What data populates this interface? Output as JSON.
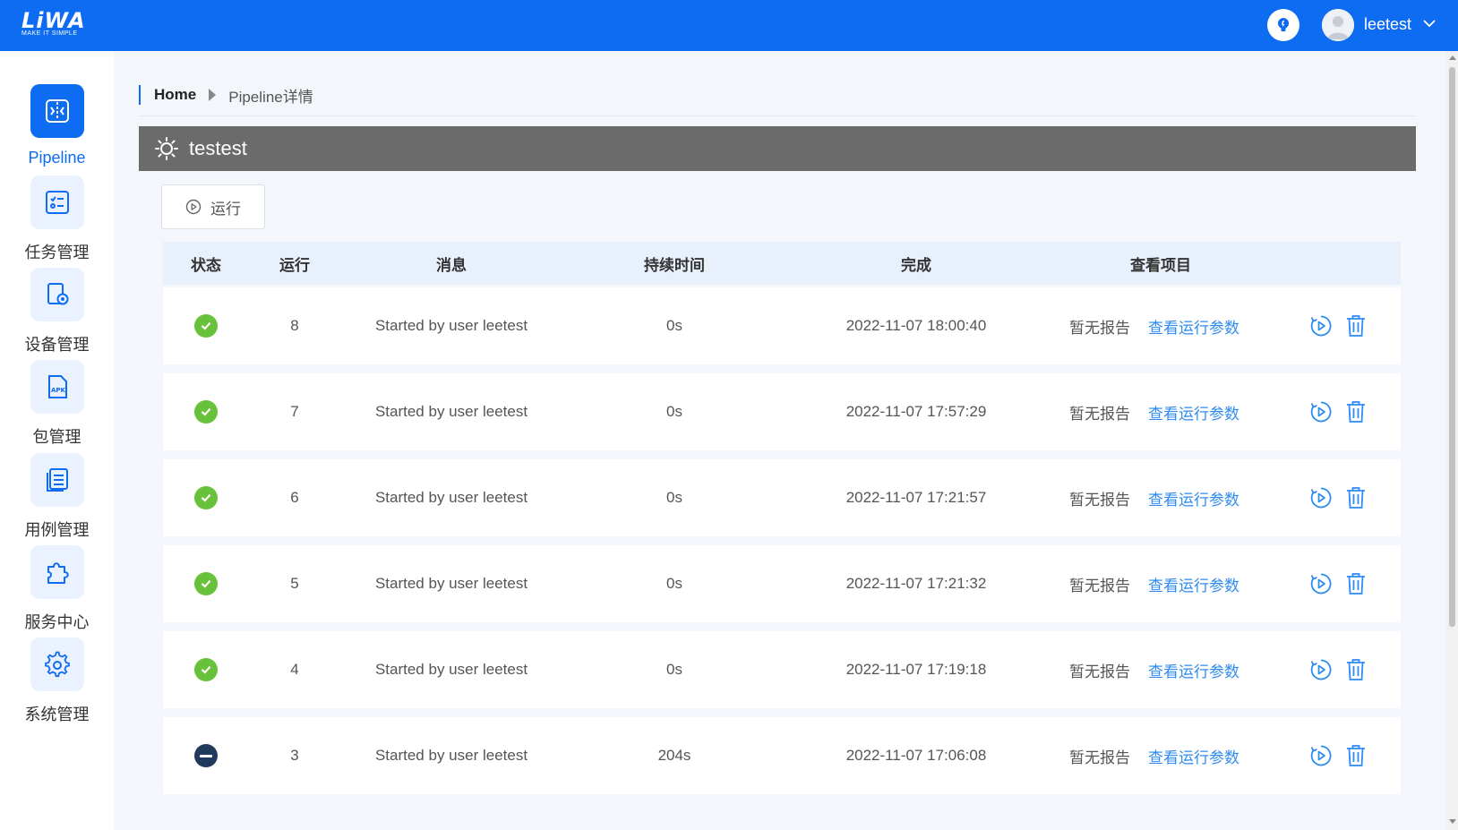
{
  "app": {
    "logo_text": "LiWA",
    "logo_tagline": "MAKE IT SIMPLE",
    "username": "leetest"
  },
  "sidebar": {
    "items": [
      {
        "label": "Pipeline",
        "icon": "pipeline-icon",
        "active": true
      },
      {
        "label": "任务管理",
        "icon": "task-list-icon"
      },
      {
        "label": "设备管理",
        "icon": "device-settings-icon"
      },
      {
        "label": "包管理",
        "icon": "apk-file-icon"
      },
      {
        "label": "用例管理",
        "icon": "case-list-icon"
      },
      {
        "label": "服务中心",
        "icon": "puzzle-icon"
      },
      {
        "label": "系统管理",
        "icon": "gear-icon"
      }
    ]
  },
  "breadcrumb": {
    "home": "Home",
    "current": "Pipeline详情"
  },
  "pipeline": {
    "name": "testest"
  },
  "toolbar": {
    "run_label": "运行"
  },
  "table": {
    "headers": {
      "status": "状态",
      "run": "运行",
      "message": "消息",
      "duration": "持续时间",
      "finished": "完成",
      "view": "查看项目"
    },
    "no_report_label": "暂无报告",
    "view_params_label": "查看运行参数",
    "rows": [
      {
        "status": "success",
        "run": "8",
        "message": "Started by user leetest",
        "duration": "0s",
        "finished": "2022-11-07 18:00:40"
      },
      {
        "status": "success",
        "run": "7",
        "message": "Started by user leetest",
        "duration": "0s",
        "finished": "2022-11-07 17:57:29"
      },
      {
        "status": "success",
        "run": "6",
        "message": "Started by user leetest",
        "duration": "0s",
        "finished": "2022-11-07 17:21:57"
      },
      {
        "status": "success",
        "run": "5",
        "message": "Started by user leetest",
        "duration": "0s",
        "finished": "2022-11-07 17:21:32"
      },
      {
        "status": "success",
        "run": "4",
        "message": "Started by user leetest",
        "duration": "0s",
        "finished": "2022-11-07 17:19:18"
      },
      {
        "status": "aborted",
        "run": "3",
        "message": "Started by user leetest",
        "duration": "204s",
        "finished": "2022-11-07 17:06:08"
      }
    ]
  },
  "colors": {
    "brand": "#0e6cf2",
    "success": "#67c23a",
    "aborted": "#1f3a5a",
    "link": "#2f8bf0"
  }
}
